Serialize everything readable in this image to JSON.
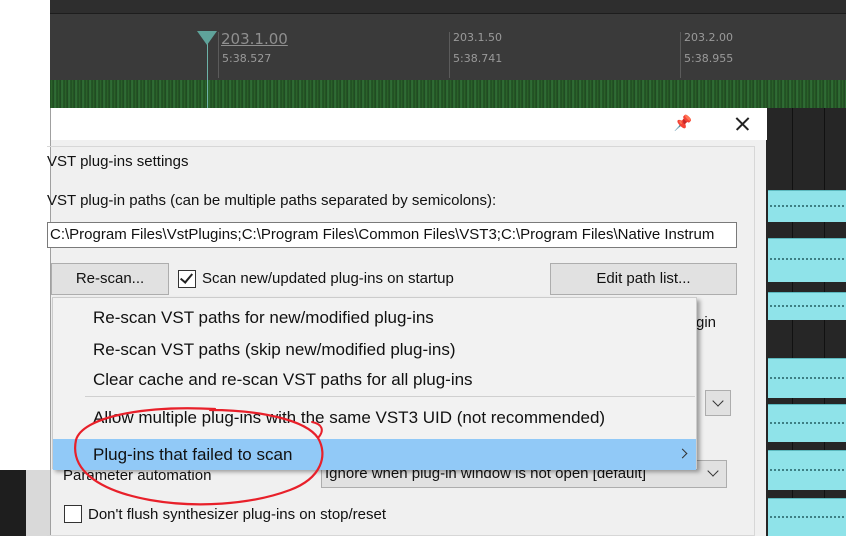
{
  "timeline": {
    "marks": [
      {
        "bars": "203.1.00",
        "time": "5:38.527"
      },
      {
        "bars": "203.1.50",
        "time": "5:38.741"
      },
      {
        "bars": "203.2.00",
        "time": "5:38.955"
      }
    ]
  },
  "dialog": {
    "pin_icon": "pin-icon",
    "section_title": "VST plug-ins settings",
    "paths_label": "VST plug-in paths (can be multiple paths separated by semicolons):",
    "paths_value": "C:\\Program Files\\VstPlugins;C:\\Program Files\\Common Files\\VST3;C:\\Program Files\\Native Instrum",
    "rescan_label": "Re-scan...",
    "scan_startup_label": "Scan new/updated plug-ins on startup",
    "scan_startup_checked": true,
    "edit_paths_label": "Edit path list...",
    "partial_right_text": "gin",
    "param_automation_label": "Parameter automation",
    "param_automation_value": "Ignore when plug-in window is not open [default]",
    "dont_flush_label": "Don't flush synthesizer plug-ins on stop/reset",
    "dont_flush_checked": false
  },
  "menu": {
    "items": [
      {
        "label": "Re-scan VST paths for new/modified plug-ins"
      },
      {
        "label": "Re-scan VST paths (skip new/modified plug-ins)"
      },
      {
        "label": "Clear cache and re-scan VST paths for all plug-ins"
      },
      {
        "label": "Allow multiple plug-ins with the same VST3 UID (not recommended)"
      },
      {
        "label": "Plug-ins that failed to scan",
        "highlighted": true,
        "has_submenu": true
      }
    ]
  },
  "colors": {
    "menu_highlight": "#91c9f7",
    "annotation_red": "#e8202a",
    "clip_cyan": "#8fe3e9",
    "waveform_green": "#2e6a2e"
  }
}
